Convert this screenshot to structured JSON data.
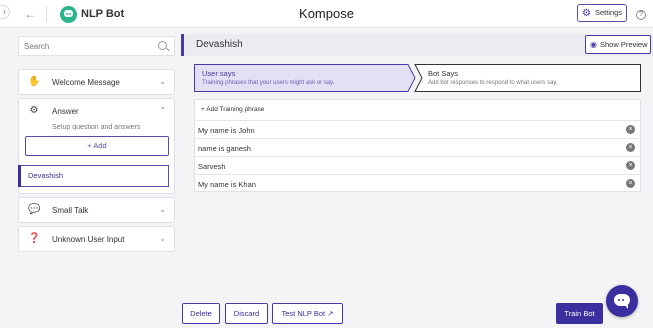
{
  "header": {
    "bot_name": "NLP Bot",
    "app_title": "Kompose",
    "settings_label": "Settings",
    "help_glyph": "?",
    "back_icon": "arrow-left-icon",
    "edge_tab_glyph": "›"
  },
  "sidebar": {
    "search_placeholder": "Search",
    "cards": {
      "welcome": {
        "label": "Welcome Message",
        "icon": "hand-wave-icon"
      },
      "answer": {
        "label": "Answer",
        "subtitle": "Setup question and answers",
        "add_label": "+ Add",
        "icon": "gear-question-icon"
      },
      "small_talk": {
        "label": "Small Talk",
        "icon": "chat-bubble-icon"
      },
      "unknown": {
        "label": "Unknown User Input",
        "icon": "question-box-icon"
      }
    },
    "selected_item": "Devashish"
  },
  "main": {
    "title": "Devashish",
    "show_preview_label": "Show Preview",
    "tabs": [
      {
        "title": "User says",
        "description": "Training phrases that your users might ask or say."
      },
      {
        "title": "Bot Says",
        "description": "Add bot responses to respond to what users say."
      }
    ],
    "add_phrase_label": "+ Add Training phrase",
    "phrases": [
      "My name is John",
      "name is ganesh",
      "Sarvesh",
      "My name is Khan"
    ]
  },
  "footer": {
    "delete_label": "Delete",
    "discard_label": "Discard",
    "test_label": "Test NLP Bot ↗",
    "train_label": "Train Bot"
  },
  "colors": {
    "accent": "#3b2e9e",
    "logo": "#2ab58b"
  }
}
